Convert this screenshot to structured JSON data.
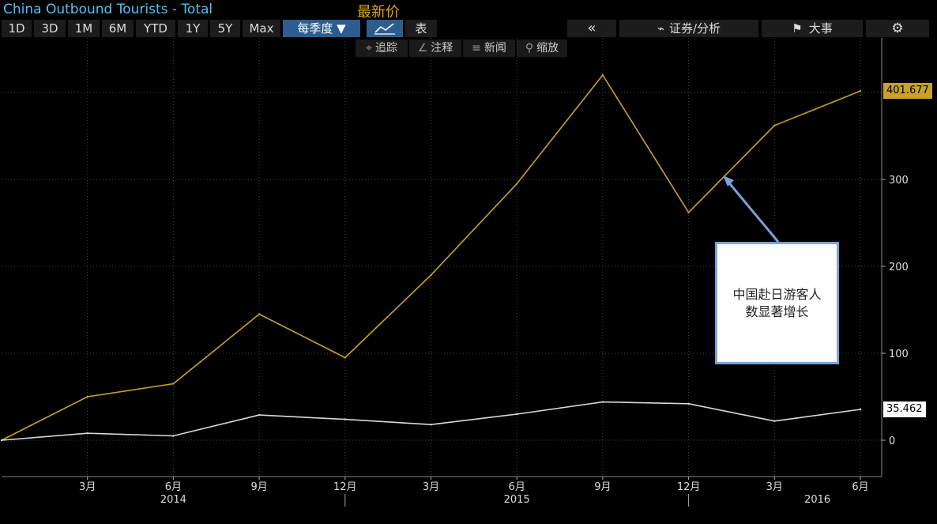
{
  "window": {
    "title": "China Outbound Tourists - Total",
    "series_label": "最新价"
  },
  "toolbar": {
    "ranges": [
      "1D",
      "3D",
      "1M",
      "6M",
      "YTD",
      "1Y",
      "5Y",
      "Max"
    ],
    "frequency": "每季度 ▼",
    "table_label": "表",
    "collapse_label": "«",
    "securities_label": "证券/分析",
    "events_label": "大事",
    "settings_icon": "gear-icon",
    "chart_icon": "line-chart-icon"
  },
  "subtoolbar": {
    "track": "追踪",
    "annotate": "注释",
    "news": "新闻",
    "zoom": "缩放"
  },
  "colors": {
    "series1": "#c9a227",
    "series2": "#d9d9d9",
    "grid": "#444444",
    "title": "#4fc3f7"
  },
  "annotation": {
    "line1": "中国赴日游客人",
    "line2": "数显著增长"
  },
  "chart_data": {
    "type": "line",
    "title": "China Outbound Tourists - Total",
    "x": [
      "2014-Q1",
      "2014-Q2",
      "2014-Q3",
      "2014-Q4",
      "2015-Q1",
      "2015-Q2",
      "2015-Q3",
      "2015-Q4",
      "2016-Q1",
      "2016-Q2",
      "2016-Q3"
    ],
    "series": [
      {
        "name": "",
        "values": [
          0,
          50,
          65,
          145,
          95,
          190,
          295,
          420,
          262,
          362,
          401.677
        ]
      },
      {
        "name": "",
        "values": [
          0,
          8,
          5,
          29,
          24,
          18,
          30,
          44,
          42,
          22,
          35.462
        ]
      }
    ],
    "last_values": [
      "401.677",
      "35.462"
    ],
    "ylim": [
      -40,
      450
    ],
    "yticks": [
      "0",
      "100",
      "200",
      "300"
    ],
    "month_labels": [
      "3月",
      "6月",
      "9月",
      "12月",
      "3月",
      "6月",
      "9月",
      "12月",
      "3月",
      "6月"
    ],
    "year_labels": [
      "2014",
      "2015",
      "2016"
    ],
    "grid": true,
    "legend": "none"
  }
}
